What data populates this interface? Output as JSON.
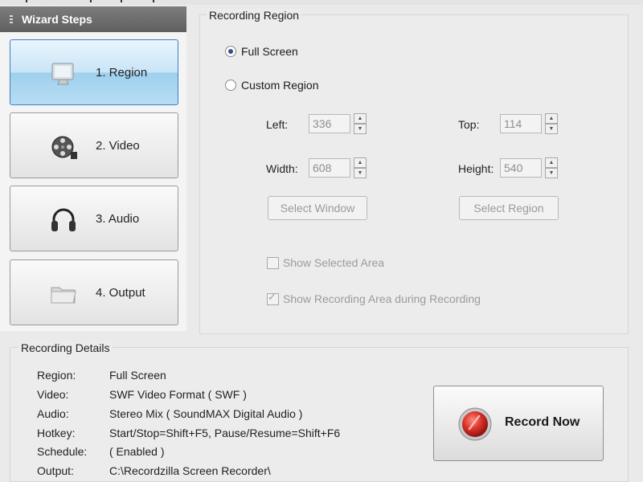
{
  "wizard": {
    "title": "Wizard Steps",
    "steps": [
      {
        "label": "1. Region",
        "icon": "monitor-icon",
        "active": true
      },
      {
        "label": "2. Video",
        "icon": "film-reel-icon",
        "active": false
      },
      {
        "label": "3. Audio",
        "icon": "headphones-icon",
        "active": false
      },
      {
        "label": "4. Output",
        "icon": "folder-icon",
        "active": false
      }
    ]
  },
  "region": {
    "group_title": "Recording Region",
    "full_screen_label": "Full Screen",
    "custom_region_label": "Custom Region",
    "selected": "Full Screen",
    "fields": {
      "left_label": "Left:",
      "left_value": "336",
      "top_label": "Top:",
      "top_value": "114",
      "width_label": "Width:",
      "width_value": "608",
      "height_label": "Height:",
      "height_value": "540"
    },
    "select_window_label": "Select Window",
    "select_region_label": "Select Region",
    "show_selected_area_label": "Show Selected Area",
    "show_selected_area_checked": false,
    "show_recording_area_label": "Show Recording Area during Recording",
    "show_recording_area_checked": true
  },
  "details": {
    "group_title": "Recording Details",
    "rows": [
      {
        "key": "Region:",
        "value": "Full Screen"
      },
      {
        "key": "Video:",
        "value": "SWF Video Format ( SWF )"
      },
      {
        "key": "Audio:",
        "value": "Stereo Mix ( SoundMAX Digital Audio )"
      },
      {
        "key": "Hotkey:",
        "value": "Start/Stop=Shift+F5, Pause/Resume=Shift+F6"
      },
      {
        "key": "Schedule:",
        "value": "( Enabled )"
      },
      {
        "key": "Output:",
        "value": "C:\\Recordzilla Screen Recorder\\"
      }
    ]
  },
  "record": {
    "label": "Record Now",
    "icon": "record-icon"
  },
  "colors": {
    "active_step": "#b7ddf3",
    "header": "#6e6e6e",
    "record_red": "#d9302a"
  }
}
